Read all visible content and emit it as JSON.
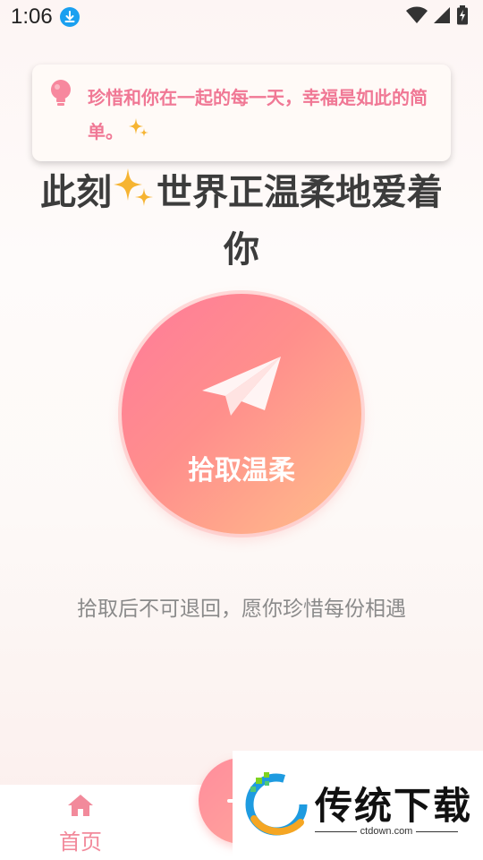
{
  "status_bar": {
    "time": "1:06",
    "icons": [
      "download-icon",
      "wifi-icon",
      "signal-icon",
      "battery-icon"
    ]
  },
  "tip": {
    "icon": "lightbulb-icon",
    "text": "珍惜和你在一起的每一天，幸福是如此的简单。"
  },
  "headline": {
    "part1": "此刻",
    "part2": "世界正温柔地爱着你"
  },
  "pick_button": {
    "icon": "paper-plane-icon",
    "label": "拾取温柔"
  },
  "hint": "拾取后不可退回，愿你珍惜每份相遇",
  "bottom_nav": {
    "home_label": "首页",
    "home_icon": "home-icon",
    "fab_icon": "plus-icon"
  },
  "watermark": {
    "title": "传统下载",
    "url": "ctdown.com"
  },
  "colors": {
    "accent": "#f07895",
    "button_start": "#ff7b9a",
    "button_end": "#ffc08a",
    "nav_active": "#f28a9b"
  }
}
